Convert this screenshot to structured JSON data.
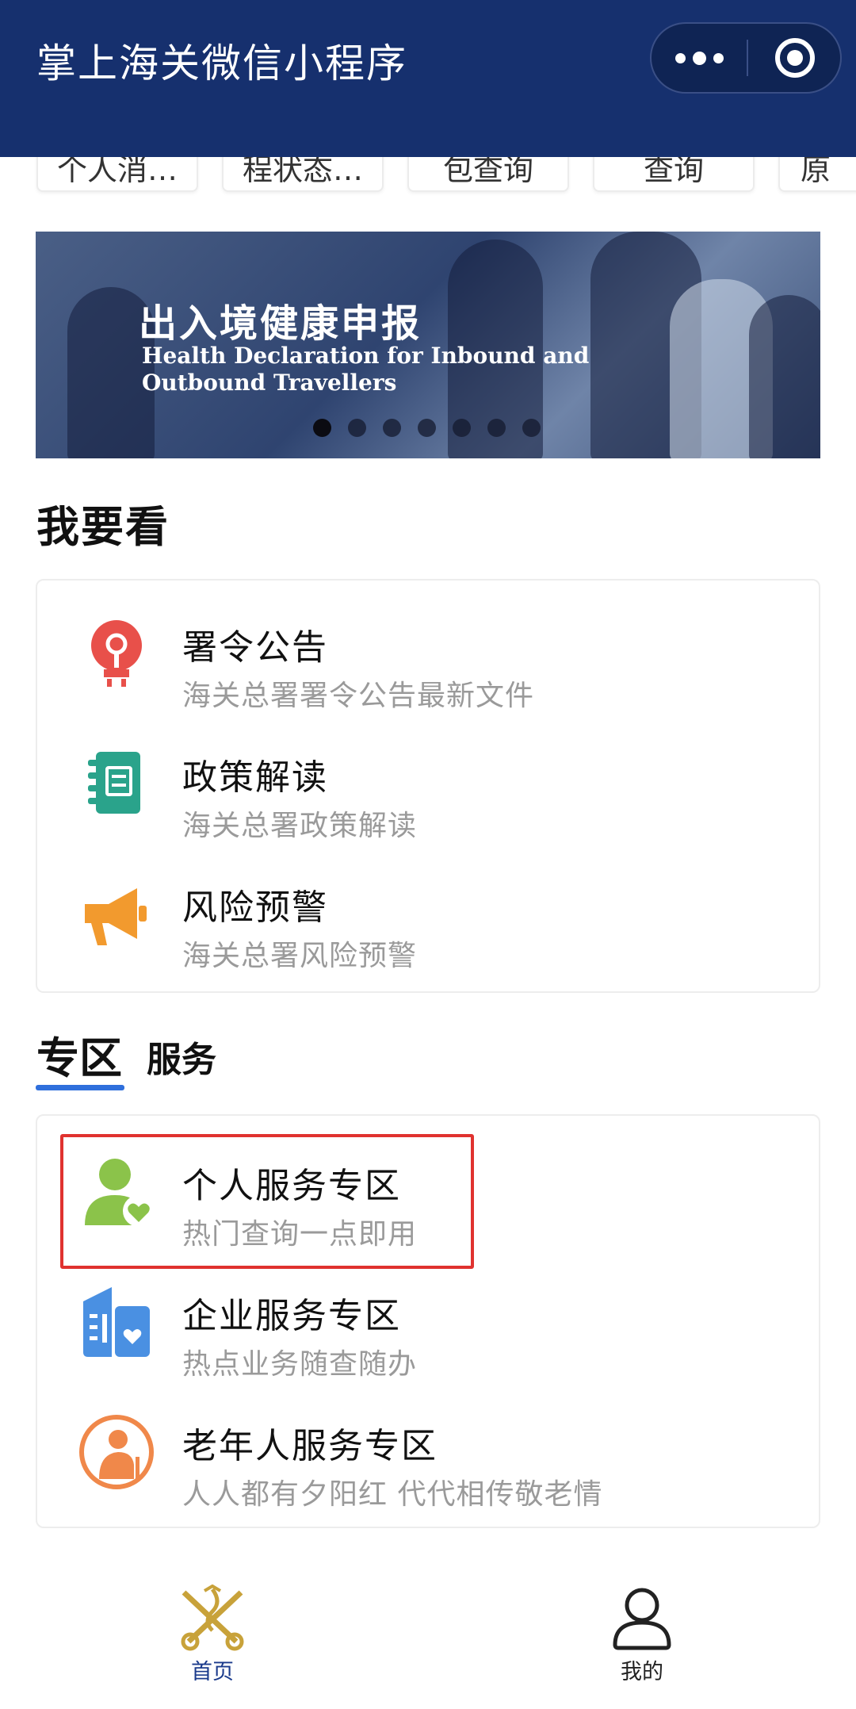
{
  "header": {
    "title": "掌上海关微信小程序",
    "more_icon": "more-dots-icon",
    "close_icon": "target-circle-icon"
  },
  "quick_tabs": [
    "个人消…",
    "程状态…",
    "包查询",
    "查询",
    "原"
  ],
  "banner": {
    "title": "出入境健康申报",
    "subtitle_line1": "Health Declaration for Inbound and",
    "subtitle_line2": "Outbound Travellers",
    "indicator": {
      "count": 7,
      "active_index": 0
    }
  },
  "watch_section": {
    "title": "我要看",
    "items": [
      {
        "title": "署令公告",
        "desc": "海关总署署令公告最新文件",
        "icon": "lightbulb-icon",
        "color": "#e8504a"
      },
      {
        "title": "政策解读",
        "desc": "海关总署政策解读",
        "icon": "notebook-icon",
        "color": "#2aa38b"
      },
      {
        "title": "风险预警",
        "desc": "海关总署风险预警",
        "icon": "megaphone-icon",
        "color": "#f29a2e"
      }
    ]
  },
  "tabs": {
    "zone": "专区",
    "service": "服务",
    "active": "专区",
    "underline_color": "#2f6fdc"
  },
  "zone_items": [
    {
      "title": "个人服务专区",
      "desc": "热门查询一点即用",
      "icon": "person-heart-icon",
      "color": "#8bc34a",
      "highlighted": true
    },
    {
      "title": "企业服务专区",
      "desc": "热点业务随查随办",
      "icon": "building-heart-icon",
      "color": "#4a90e2",
      "highlighted": false
    },
    {
      "title": "老年人服务专区",
      "desc": "人人都有夕阳红 代代相传敬老情",
      "icon": "elderly-person-icon",
      "color": "#f0884a",
      "highlighted": false
    }
  ],
  "bottom_nav": [
    {
      "label": "首页",
      "icon": "customs-emblem-icon",
      "active": true
    },
    {
      "label": "我的",
      "icon": "user-icon",
      "active": false
    }
  ],
  "colors": {
    "header_bg": "#16306e",
    "highlight_border": "#e0322f",
    "active_nav": "#1b3b8c"
  }
}
